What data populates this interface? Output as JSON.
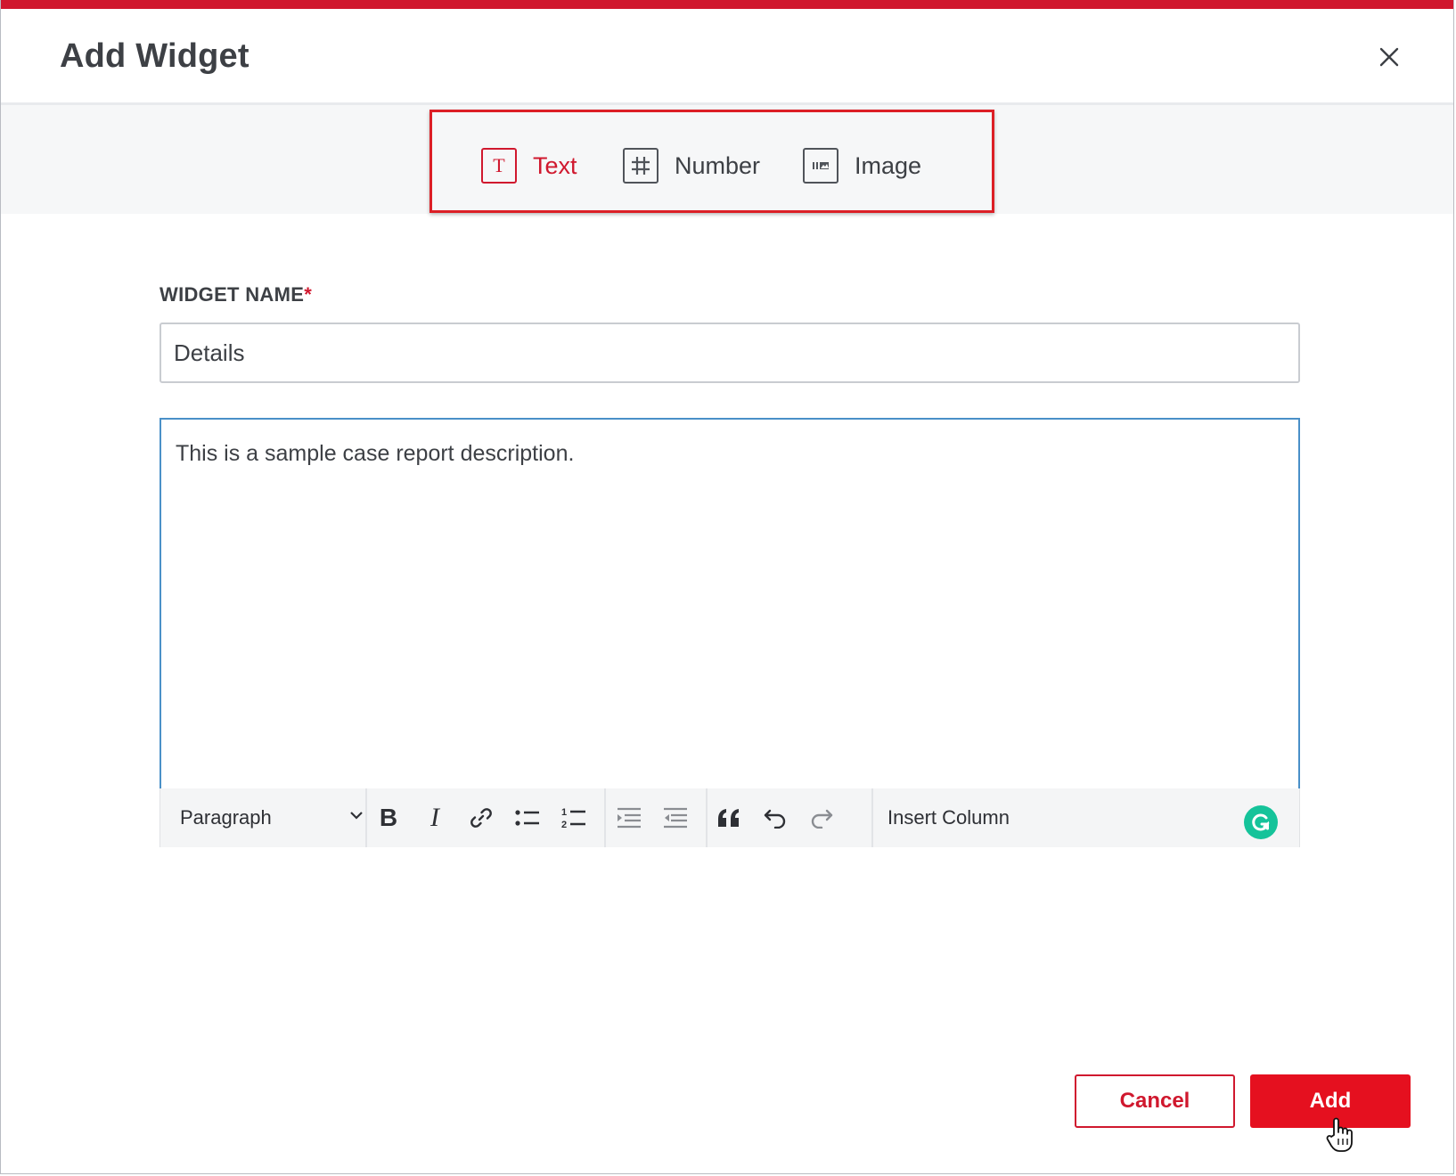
{
  "dialog": {
    "title": "Add Widget",
    "close_icon": "close-icon",
    "accent_color": "#d0182e"
  },
  "widget_types": [
    {
      "label": "Text",
      "icon": "text-type-icon",
      "active": true
    },
    {
      "label": "Number",
      "icon": "hash-icon",
      "active": false
    },
    {
      "label": "Image",
      "icon": "image-icon",
      "active": false
    }
  ],
  "form": {
    "name_label": "WIDGET NAME",
    "required_mark": "*",
    "name_value": "Details",
    "description": "This is a sample case report description."
  },
  "toolbar": {
    "block_format": "Paragraph",
    "buttons": [
      "bold-icon",
      "italic-icon",
      "link-icon",
      "bulleted-list-icon",
      "numbered-list-icon",
      "outdent-icon",
      "indent-icon",
      "blockquote-icon",
      "undo-icon",
      "redo-icon"
    ],
    "insert_column": "Insert Column",
    "grammarly_color": "#15c39a"
  },
  "footer": {
    "cancel_label": "Cancel",
    "add_label": "Add"
  }
}
